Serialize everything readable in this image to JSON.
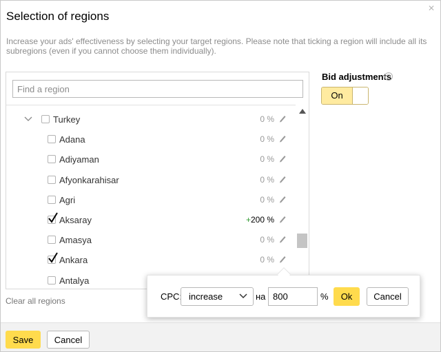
{
  "dialog": {
    "title": "Selection of regions",
    "close_icon": "close-icon",
    "description": "Increase your ads' effectiveness by selecting your target regions. Please note that ticking a region will include all its subregions (even if you cannot choose them individually)."
  },
  "search": {
    "placeholder": "Find a region",
    "value": ""
  },
  "regions": [
    {
      "label": "Turkey",
      "checked": false,
      "expanded": true,
      "pct": "0 %",
      "plus": ""
    },
    {
      "label": "Adana",
      "checked": false,
      "pct": "0 %",
      "plus": ""
    },
    {
      "label": "Adiyaman",
      "checked": false,
      "pct": "0 %",
      "plus": ""
    },
    {
      "label": "Afyonkarahisar",
      "checked": false,
      "pct": "0 %",
      "plus": ""
    },
    {
      "label": "Agri",
      "checked": false,
      "pct": "0 %",
      "plus": ""
    },
    {
      "label": "Aksaray",
      "checked": true,
      "pct": "200 %",
      "plus": "+"
    },
    {
      "label": "Amasya",
      "checked": false,
      "pct": "0 %",
      "plus": ""
    },
    {
      "label": "Ankara",
      "checked": true,
      "pct": "0 %",
      "plus": ""
    },
    {
      "label": "Antalya",
      "checked": false,
      "pct": "",
      "plus": ""
    }
  ],
  "clear_all": "Clear all regions",
  "bid": {
    "label": "Bid adjustments",
    "help_icon": "?",
    "toggle_label": "On",
    "toggle_state": true
  },
  "cpc_popup": {
    "label": "CPC:",
    "mode": "increase",
    "connector": "на",
    "value": "800",
    "unit": "%",
    "ok_label": "Ok",
    "cancel_label": "Cancel"
  },
  "footer": {
    "save_label": "Save",
    "cancel_label": "Cancel"
  },
  "colors": {
    "accent": "#ffdb4d",
    "toggle_on": "#ffeba0",
    "positive": "#2f9a2f"
  }
}
